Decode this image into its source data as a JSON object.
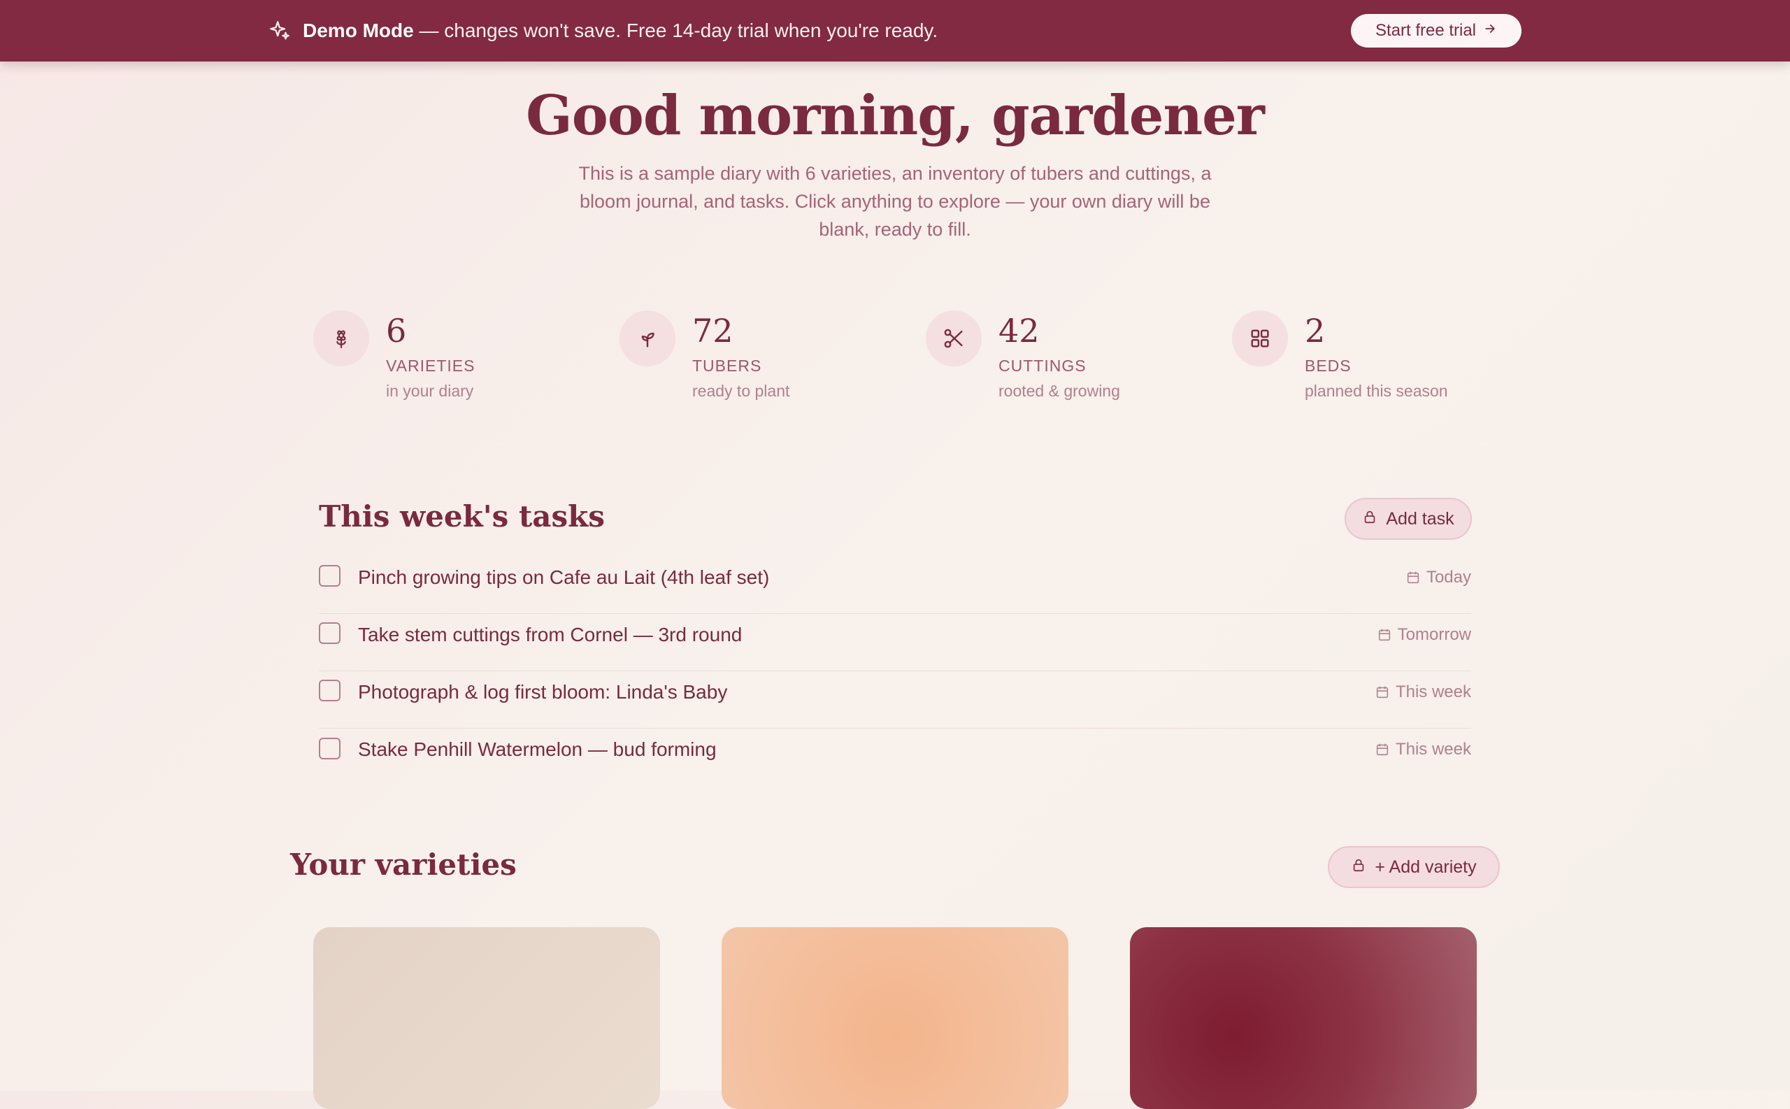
{
  "banner": {
    "mode_label": "Demo Mode",
    "message": "— changes won't save. Free 14-day trial when you're ready.",
    "cta_label": "Start free trial",
    "icon": "sparkle-icon"
  },
  "hero": {
    "title": "Good morning, gardener",
    "subtitle": "This is a sample diary with 6 varieties, an inventory of tubers and cuttings, a bloom journal, and tasks. Click anything to explore — your own diary will be blank, ready to fill."
  },
  "stats": [
    {
      "icon": "flower-icon",
      "value": "6",
      "label": "VARIETIES",
      "desc": "in your diary"
    },
    {
      "icon": "sprout-icon",
      "value": "72",
      "label": "TUBERS",
      "desc": "ready to plant"
    },
    {
      "icon": "scissors-icon",
      "value": "42",
      "label": "CUTTINGS",
      "desc": "rooted & growing"
    },
    {
      "icon": "grid-icon",
      "value": "2",
      "label": "BEDS",
      "desc": "planned this season"
    }
  ],
  "tasks": {
    "title": "This week's tasks",
    "add_label": "Add task",
    "items": [
      {
        "text": "Pinch growing tips on Cafe au Lait (4th leaf set)",
        "due": "Today",
        "done": false
      },
      {
        "text": "Take stem cuttings from Cornel — 3rd round",
        "due": "Tomorrow",
        "done": false
      },
      {
        "text": "Photograph & log first bloom: Linda's Baby",
        "due": "This week",
        "done": false
      },
      {
        "text": "Stake Penhill Watermelon — bud forming",
        "due": "This week",
        "done": false
      }
    ]
  },
  "varieties": {
    "title": "Your varieties",
    "add_label": "+ Add variety",
    "card_colors": [
      "#e6d2c4",
      "#f3b992",
      "#862c3f"
    ]
  },
  "colors": {
    "brand": "#822a42",
    "accent_soft": "#f4dfe1",
    "text": "#7a2a3e"
  }
}
